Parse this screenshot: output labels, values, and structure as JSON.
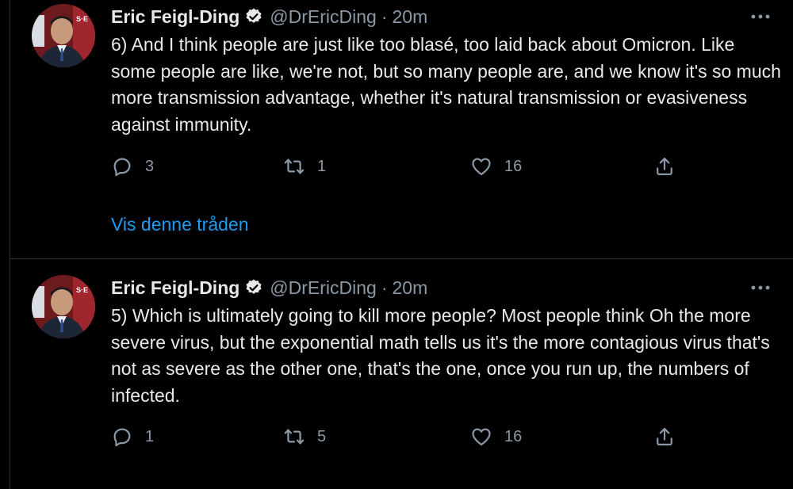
{
  "tweets": [
    {
      "author_name": "Eric Feigl-Ding",
      "handle": "@DrEricDing",
      "separator": "·",
      "time": "20m",
      "avatar_badge": "S·E",
      "text": "6) And I think people are just like too blasé, too laid back about Omicron. Like some people are like, we're not, but so many people are, and we know it's so much more transmission advantage, whether it's natural transmission or evasiveness against immunity.",
      "replies": "3",
      "retweets": "1",
      "likes": "16",
      "show_thread_label": "Vis denne tråden"
    },
    {
      "author_name": "Eric Feigl-Ding",
      "handle": "@DrEricDing",
      "separator": "·",
      "time": "20m",
      "avatar_badge": "S·E",
      "text": "5) Which is ultimately going to kill more people? Most people think Oh the more severe virus, but the exponential math tells us it's the more contagious virus that's not as severe as the other one, that's the one, once you run up, the numbers of infected.",
      "replies": "1",
      "retweets": "5",
      "likes": "16"
    }
  ],
  "icons": {
    "verified": "verified-badge-icon",
    "more": "more-options-icon",
    "reply": "reply-icon",
    "retweet": "retweet-icon",
    "like": "like-icon",
    "share": "share-icon"
  },
  "colors": {
    "background": "#000000",
    "text": "#e7e9ea",
    "secondary": "#8b98a5",
    "link": "#1d9bf0",
    "divider": "#2f3336"
  }
}
